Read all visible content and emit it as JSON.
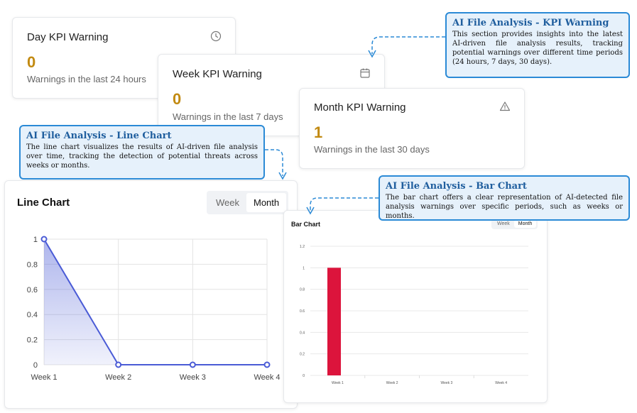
{
  "kpi_cards": {
    "day": {
      "title": "Day KPI Warning",
      "value": "0",
      "subtitle": "Warnings in the last 24 hours",
      "icon": "clock-icon"
    },
    "week": {
      "title": "Week KPI Warning",
      "value": "0",
      "subtitle": "Warnings in the last 7 days",
      "icon": "calendar-icon"
    },
    "month": {
      "title": "Month KPI Warning",
      "value": "1",
      "subtitle": "Warnings in the last 30 days",
      "icon": "warning-triangle-icon"
    }
  },
  "callouts": {
    "kpi": {
      "title": "AI File Analysis - KPI Warning",
      "body": "This section provides insights into the latest AI-driven file analysis results, tracking potential warnings over different time periods (24 hours, 7 days, 30 days)."
    },
    "line": {
      "title": "AI File Analysis - Line Chart",
      "body": "The line chart visualizes the results of AI-driven file analysis over time, tracking the detection of potential threats across weeks or months."
    },
    "bar": {
      "title": "AI File Analysis - Bar Chart",
      "body": "The bar chart offers a clear representation of AI-detected file analysis warnings over specific periods, such as weeks or months."
    }
  },
  "line_panel": {
    "title": "Line Chart",
    "toggle": {
      "week": "Week",
      "month": "Month",
      "active": "month"
    }
  },
  "bar_panel": {
    "title": "Bar Chart",
    "toggle": {
      "week": "Week",
      "month": "Month",
      "active": "month"
    }
  },
  "colors": {
    "accent": "#2b8ad6",
    "kpi_value": "#c28a12",
    "line": "#4a5bd6",
    "bar": "#dc143c"
  },
  "chart_data": [
    {
      "type": "line",
      "title": "Line Chart",
      "categories": [
        "Week 1",
        "Week 2",
        "Week 3",
        "Week 4"
      ],
      "values": [
        1,
        0,
        0,
        0
      ],
      "yticks": [
        "0",
        "0.2",
        "0.4",
        "0.6",
        "0.8",
        "1"
      ],
      "ylim": [
        0,
        1
      ],
      "grid": true,
      "area_fill": true
    },
    {
      "type": "bar",
      "title": "Bar Chart",
      "categories": [
        "Week 1",
        "Week 2",
        "Week 3",
        "Week 4"
      ],
      "values": [
        1,
        0,
        0,
        0
      ],
      "yticks": [
        "0",
        "0.2",
        "0.4",
        "0.6",
        "0.8",
        "1",
        "1.2"
      ],
      "ylim": [
        0,
        1.2
      ],
      "grid": true
    }
  ]
}
